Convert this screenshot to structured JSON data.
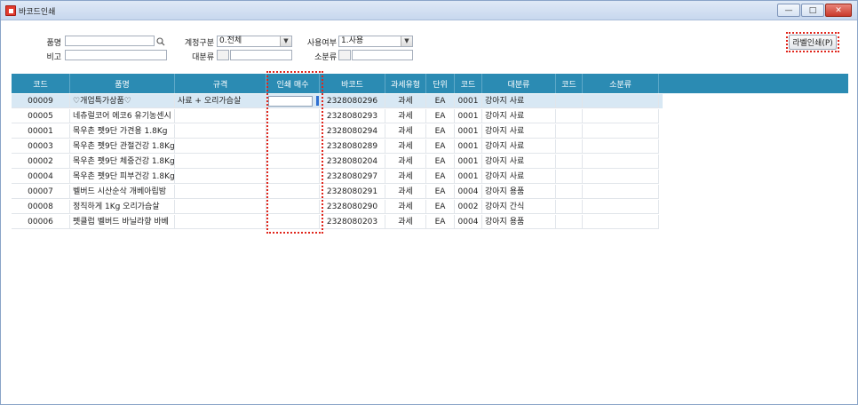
{
  "window": {
    "title": "바코드인쇄"
  },
  "search": {
    "item_label": "품명",
    "item_value": "",
    "note_label": "비고",
    "note_value": "",
    "account_label": "계정구분",
    "account_value": "0.전체",
    "category_label": "대분류",
    "category_code": "",
    "category_value": "",
    "use_label": "사용여부",
    "use_value": "1.사용",
    "subcategory_label": "소분류",
    "subcategory_code": "",
    "subcategory_value": ""
  },
  "toolbar": {
    "print_label": "라벨인쇄(P)"
  },
  "grid": {
    "headers": [
      "코드",
      "품명",
      "규격",
      "인쇄 매수",
      "바코드",
      "과세유형",
      "단위",
      "코드",
      "대분류",
      "코드",
      "소분류"
    ],
    "rows": [
      [
        "00009",
        "♡개업특가상품♡",
        "사료 + 오리가슴살",
        "",
        "2328080296",
        "과세",
        "EA",
        "0001",
        "강아지 사료",
        "",
        ""
      ],
      [
        "00005",
        "네츄럴코어 에코6 유기농센시",
        "",
        "",
        "2328080293",
        "과세",
        "EA",
        "0001",
        "강아지 사료",
        "",
        ""
      ],
      [
        "00001",
        "목우촌 펫9단 가견용 1.8Kg",
        "",
        "",
        "2328080294",
        "과세",
        "EA",
        "0001",
        "강아지 사료",
        "",
        ""
      ],
      [
        "00003",
        "목우촌 펫9단 관절건강 1.8Kg",
        "",
        "",
        "2328080289",
        "과세",
        "EA",
        "0001",
        "강아지 사료",
        "",
        ""
      ],
      [
        "00002",
        "목우촌 펫9단 체중건강 1.8Kg",
        "",
        "",
        "2328080204",
        "과세",
        "EA",
        "0001",
        "강아지 사료",
        "",
        ""
      ],
      [
        "00004",
        "목우촌 펫9단 피부건강 1.8Kg",
        "",
        "",
        "2328080297",
        "과세",
        "EA",
        "0001",
        "강아지 사료",
        "",
        ""
      ],
      [
        "00007",
        "벨버드 시산순삭 개베아립밤",
        "",
        "",
        "2328080291",
        "과세",
        "EA",
        "0004",
        "강아지 용품",
        "",
        ""
      ],
      [
        "00008",
        "정직하게 1Kg 오리가슴살",
        "",
        "",
        "2328080290",
        "과세",
        "EA",
        "0002",
        "강아지 간식",
        "",
        ""
      ],
      [
        "00006",
        "펫클럽 벨버드 바닐라향 바베",
        "",
        "",
        "2328080203",
        "과세",
        "EA",
        "0004",
        "강아지 용품",
        "",
        ""
      ]
    ]
  },
  "colors": {
    "header_bg": "#2b8bb3",
    "selected_row": "#d8e8f4",
    "highlight": "#e0261c"
  }
}
